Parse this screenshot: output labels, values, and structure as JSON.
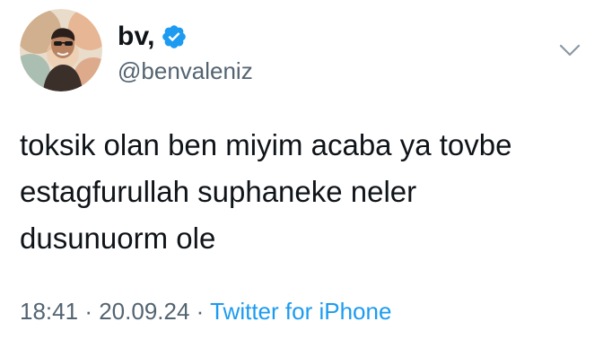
{
  "author": {
    "display_name": "bv,",
    "handle": "@benvaleniz",
    "verified": true,
    "avatar_icon": "profile-photo"
  },
  "tweet": {
    "lines": [
      "toksik olan ben miyim acaba ya tovbe",
      "estagfurullah suphaneke neler",
      "dusunuorm ole"
    ],
    "time": "18:41",
    "separator": "·",
    "date": "20.09.24",
    "source": "Twitter for iPhone"
  },
  "icons": {
    "verified": "verified-badge-icon",
    "more": "chevron-down-icon"
  },
  "colors": {
    "accent": "#1d9bf0",
    "secondary_text": "#536471",
    "primary_text": "#0f1419"
  }
}
